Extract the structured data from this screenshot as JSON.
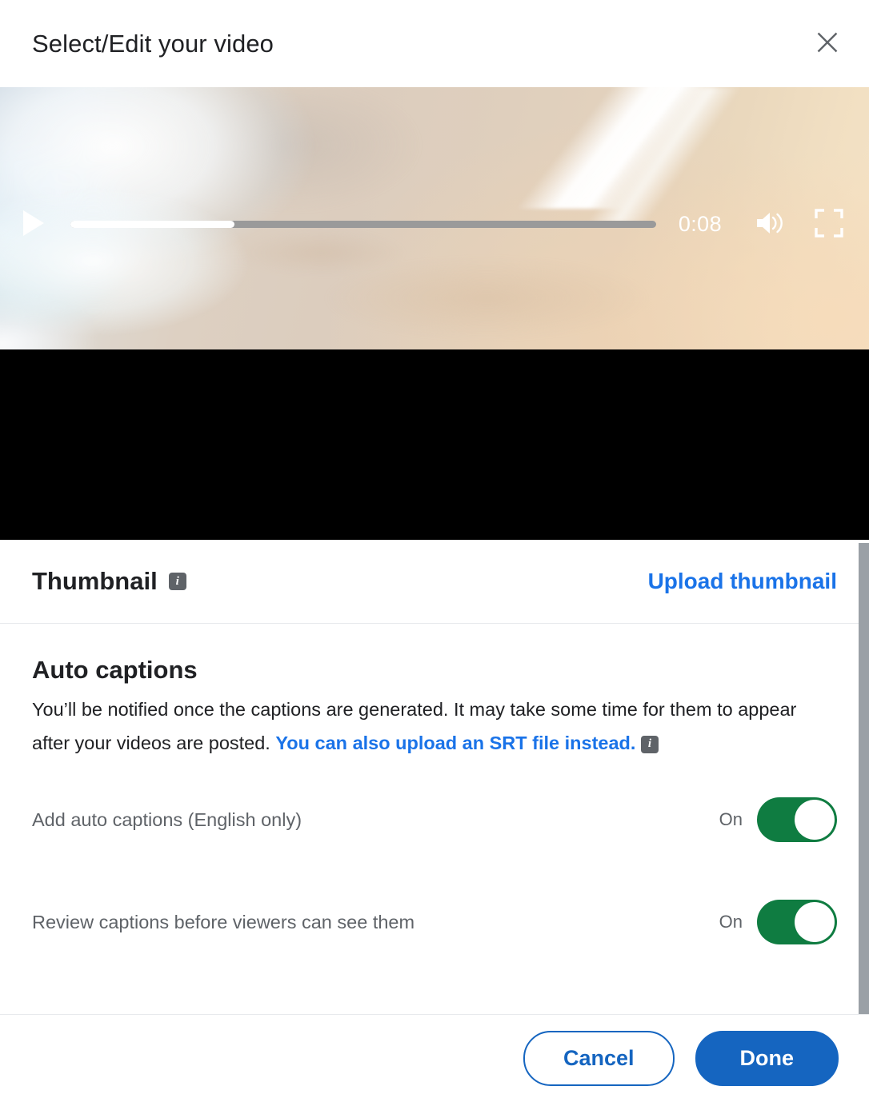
{
  "dialog": {
    "title": "Select/Edit your video",
    "close_icon": "close-icon"
  },
  "player": {
    "play_icon": "play-icon",
    "time": "0:08",
    "progress_percent": 28,
    "volume_icon": "volume-on-icon",
    "fullscreen_icon": "fullscreen-icon"
  },
  "thumbnail": {
    "title": "Thumbnail",
    "info_icon": "info-icon",
    "upload_link": "Upload thumbnail"
  },
  "auto_captions": {
    "title": "Auto captions",
    "description_part1": "You’ll be notified once the captions are generated. It may take some time for them to appear after your videos are posted. ",
    "description_link": "You can also upload an SRT file instead.",
    "info_icon": "info-icon",
    "toggles": [
      {
        "label": "Add auto captions (English only)",
        "state": "On",
        "on": true
      },
      {
        "label": "Review captions before viewers can see them",
        "state": "On",
        "on": true
      }
    ]
  },
  "footer": {
    "cancel_label": "Cancel",
    "done_label": "Done"
  },
  "colors": {
    "link_blue": "#1a73e8",
    "button_blue": "#1565c0",
    "toggle_green": "#0f7c41",
    "text_primary": "#202124",
    "text_secondary": "#5f6368"
  }
}
